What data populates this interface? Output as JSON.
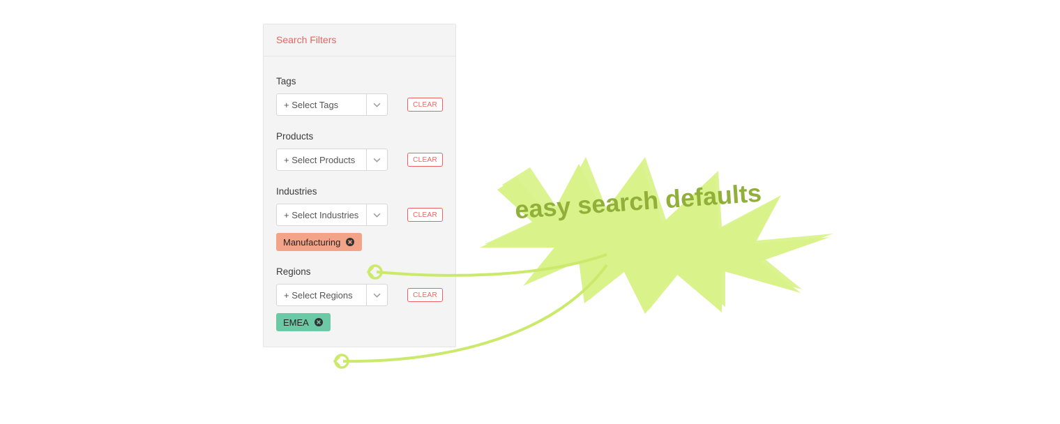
{
  "panel": {
    "title": "Search Filters",
    "clear_label": "CLEAR",
    "filters": {
      "tags": {
        "label": "Tags",
        "placeholder": "+ Select Tags",
        "selected": []
      },
      "products": {
        "label": "Products",
        "placeholder": "+ Select Products",
        "selected": []
      },
      "industries": {
        "label": "Industries",
        "placeholder": "+ Select Industries",
        "selected": [
          "Manufacturing"
        ]
      },
      "regions": {
        "label": "Regions",
        "placeholder": "+ Select Regions",
        "selected": [
          "EMEA"
        ]
      }
    }
  },
  "annotation": {
    "text": "easy search defaults",
    "fill": "#d9f28a",
    "stroke": "#cbe96a"
  }
}
